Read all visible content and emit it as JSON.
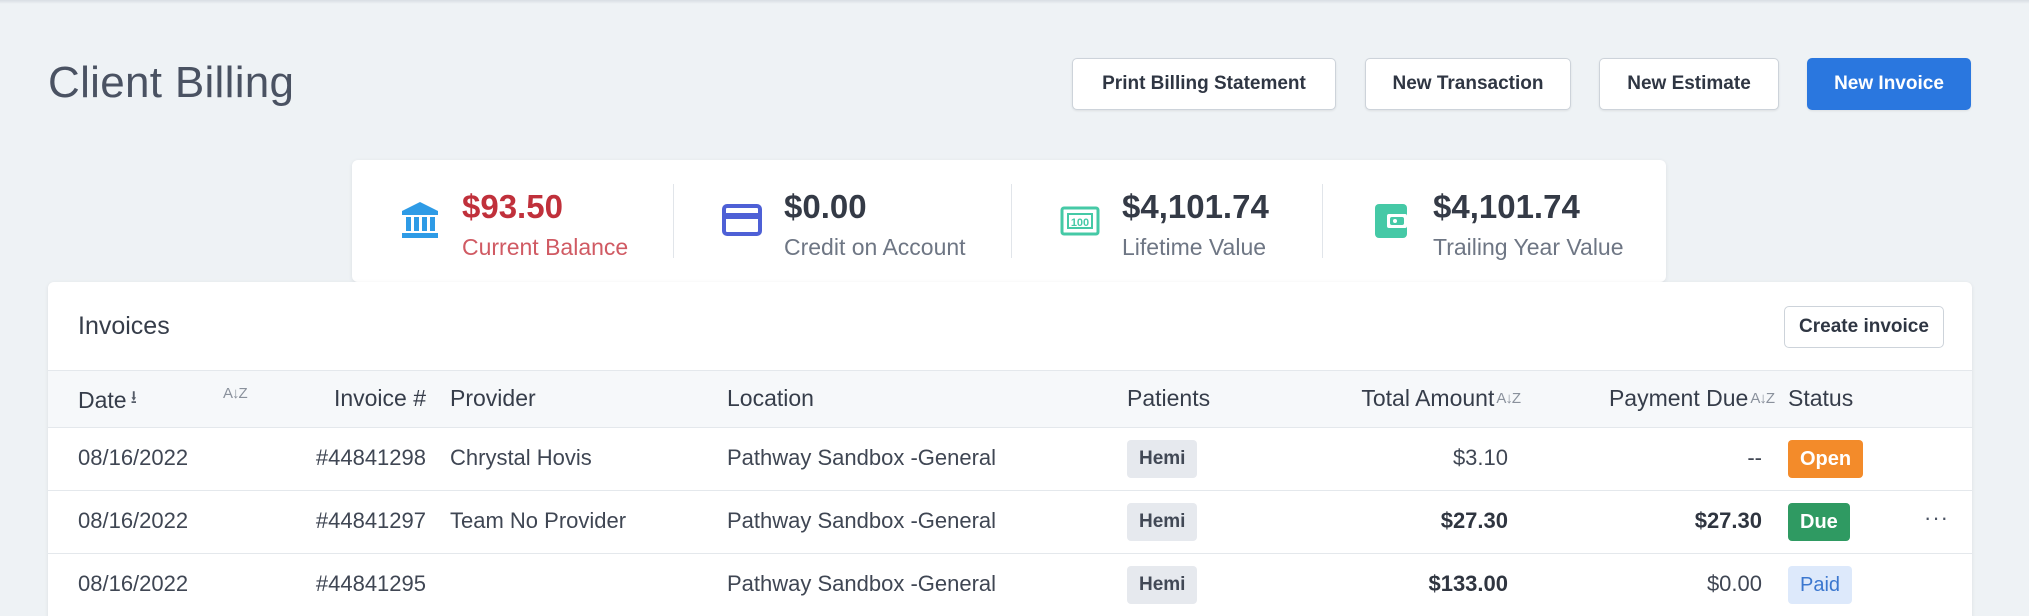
{
  "header": {
    "title": "Client Billing",
    "buttons": {
      "print_statement": "Print Billing Statement",
      "new_transaction": "New Transaction",
      "new_estimate": "New Estimate",
      "new_invoice": "New Invoice"
    }
  },
  "stats": [
    {
      "icon": "bank-icon",
      "value": "$93.50",
      "label": "Current Balance",
      "color": "#c0303b",
      "label_color": "#d05a63",
      "icon_color": "#2e9be6"
    },
    {
      "icon": "credit-card-icon",
      "value": "$0.00",
      "label": "Credit on Account",
      "color": "#343a46",
      "icon_color": "#4e60d6"
    },
    {
      "icon": "cash-icon",
      "value": "$4,101.74",
      "label": "Lifetime Value",
      "color": "#343a46",
      "icon_color": "#45c9a6"
    },
    {
      "icon": "wallet-icon",
      "value": "$4,101.74",
      "label": "Trailing Year Value",
      "color": "#343a46",
      "icon_color": "#45c9a6"
    }
  ],
  "invoices": {
    "title": "Invoices",
    "create_label": "Create invoice",
    "columns": {
      "date": "Date",
      "invoice_no": "Invoice #",
      "provider": "Provider",
      "location": "Location",
      "patients": "Patients",
      "total_amount": "Total Amount",
      "payment_due": "Payment Due",
      "status": "Status"
    },
    "sort_az_glyph": "A↓Z",
    "sort_down_glyph": "⭳",
    "rows": [
      {
        "date": "08/16/2022",
        "invoice_no": "#44841298",
        "provider": "Chrystal Hovis",
        "location": "Pathway Sandbox -General",
        "patient": "Hemi",
        "total": "$3.10",
        "due": "--",
        "status": "Open"
      },
      {
        "date": "08/16/2022",
        "invoice_no": "#44841297",
        "provider": "Team No Provider",
        "location": "Pathway Sandbox -General",
        "patient": "Hemi",
        "total": "$27.30",
        "due": "$27.30",
        "status": "Due",
        "more": "···"
      },
      {
        "date": "08/16/2022",
        "invoice_no": "#44841295",
        "provider": "",
        "location": "Pathway Sandbox -General",
        "patient": "Hemi",
        "total": "$133.00",
        "due": "$0.00",
        "status": "Paid"
      }
    ],
    "status_colors": {
      "open": {
        "bg": "#f38b2a",
        "fg": "#ffffff"
      },
      "due": {
        "bg": "#2f9a62",
        "fg": "#ffffff"
      },
      "paid": {
        "bg": "#dde9fb",
        "fg": "#3b77cf"
      }
    }
  }
}
